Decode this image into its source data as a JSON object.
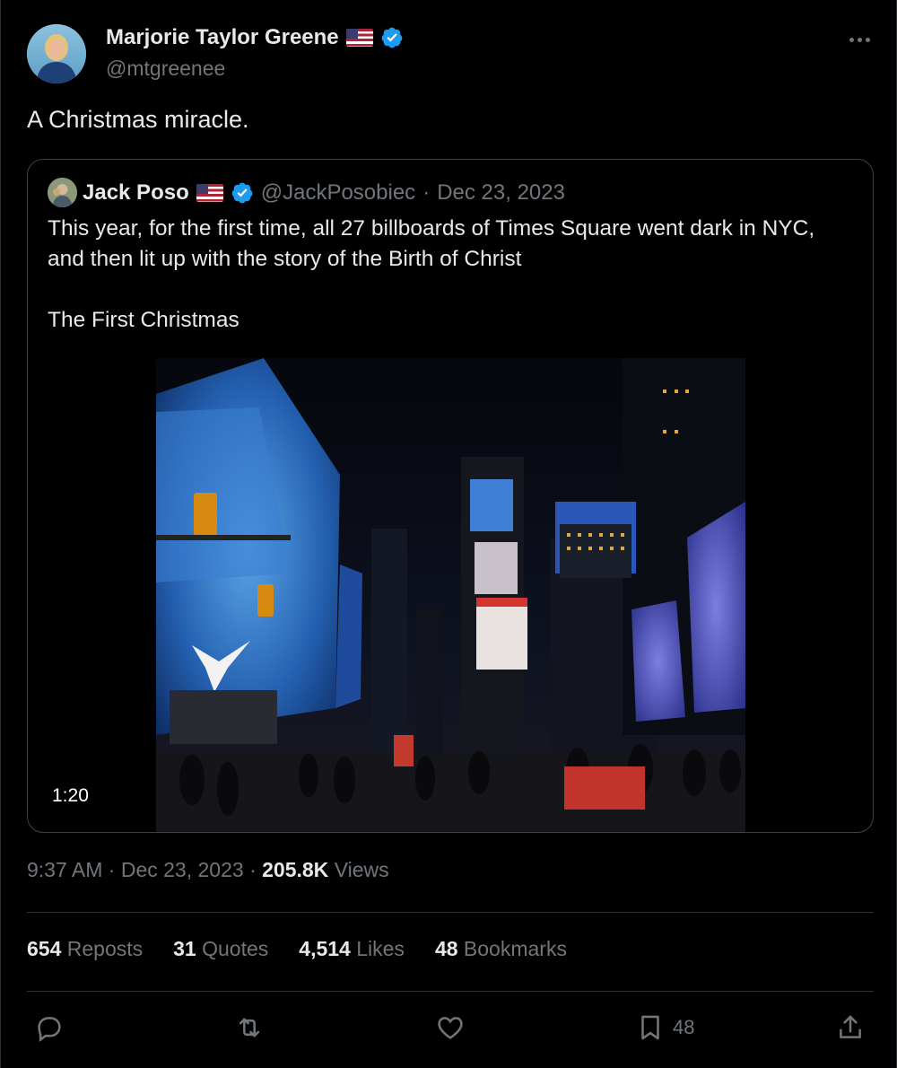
{
  "colors": {
    "background": "#000000",
    "text": "#e7e9ea",
    "muted": "#71767b",
    "verified": "#1d9bf0",
    "border": "#2f3336"
  },
  "author": {
    "name": "Marjorie Taylor Greene",
    "handle": "@mtgreenee",
    "flag_icon": "us-flag-icon",
    "badge_icon": "verified-badge-icon"
  },
  "tweet": {
    "text": "A Christmas miracle."
  },
  "quoted": {
    "name": "Jack Poso",
    "handle": "@JackPosobiec",
    "separator": "·",
    "date": "Dec 23, 2023",
    "paragraph1": "This year, for the first time, all 27 billboards of Times Square went dark in NYC,\nand then lit up with the story of the Birth of Christ",
    "paragraph2": "The First Christmas",
    "video_duration": "1:20"
  },
  "meta": {
    "time": "9:37 AM",
    "separator": "·",
    "date": "Dec 23, 2023",
    "separator2": "·",
    "views_count": "205.8K",
    "views_label": "Views"
  },
  "stats": [
    {
      "count": "654",
      "label": "Reposts"
    },
    {
      "count": "31",
      "label": "Quotes"
    },
    {
      "count": "4,514",
      "label": "Likes"
    },
    {
      "count": "48",
      "label": "Bookmarks"
    }
  ],
  "actions": {
    "reply_icon": "reply-icon",
    "repost_icon": "repost-icon",
    "like_icon": "heart-icon",
    "bookmark_icon": "bookmark-icon",
    "bookmark_count": "48",
    "share_icon": "share-icon"
  }
}
